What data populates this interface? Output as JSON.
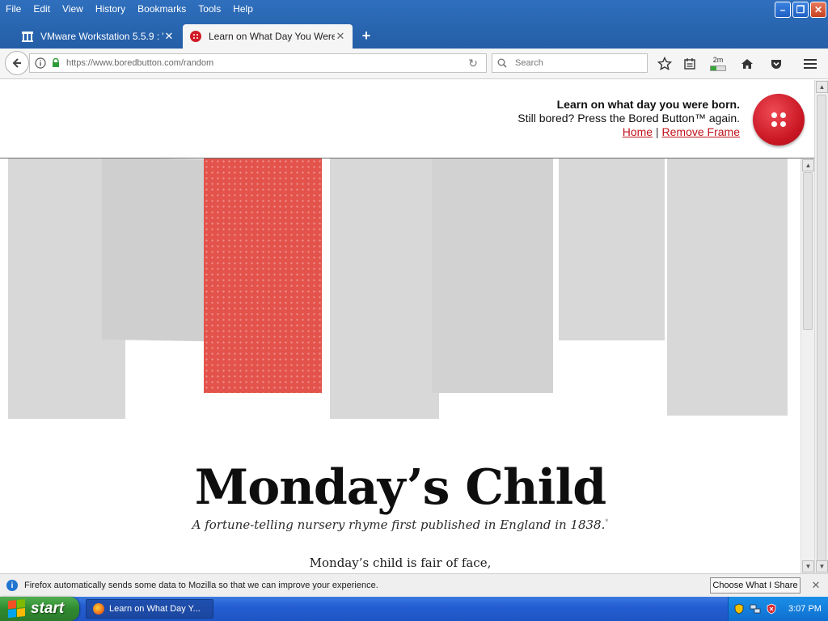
{
  "menu": [
    "File",
    "Edit",
    "View",
    "History",
    "Bookmarks",
    "Tools",
    "Help"
  ],
  "tabs": [
    {
      "label": "VMware Workstation 5.5.9 : V...",
      "icon": "vmware-icon",
      "state": "inactive"
    },
    {
      "label": "Learn on What Day You Were...",
      "icon": "bored-button-favicon",
      "state": "active"
    }
  ],
  "nav": {
    "url": "https://www.boredbutton.com/random",
    "search_placeholder": "Search",
    "badge": "2m"
  },
  "page": {
    "header": {
      "title": "Learn on what day you were born.",
      "subtitle": "Still bored? Press the Bored Button™ again.",
      "home_link": "Home",
      "separator": "|",
      "remove_frame_link": "Remove Frame"
    },
    "headline": "Monday’s Child",
    "subtitle": "A fortune-telling nursery rhyme first published in England in 1838.",
    "footnote_mark": "*",
    "verse_line": "Monday’s child is fair of face,"
  },
  "notification": {
    "message": "Firefox automatically sends some data to Mozilla so that we can improve your experience.",
    "button": "Choose What I Share"
  },
  "taskbar": {
    "start_label": "start",
    "task_item": "Learn on What Day Y...",
    "clock": "3:07 PM"
  },
  "colors": {
    "accent_red": "#e3534b",
    "link_red": "#c0121b",
    "button_red": "#c81623",
    "titlebar_blue": "#245ea6"
  }
}
